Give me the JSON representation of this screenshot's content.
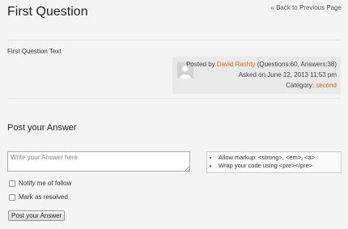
{
  "page": {
    "title": "First Question",
    "back_link": "« Back to Previous Page"
  },
  "question": {
    "text": "First Question Text",
    "author": {
      "posted_by_label": "Posted by",
      "name": "David Rashty",
      "stats": "(Questions:60, Answers:38)",
      "asked_on": "Asked on June 12, 2013 11:53 pm",
      "category_label": "Category:",
      "category": "second"
    }
  },
  "answer_form": {
    "heading": "Post your Answer",
    "placeholder": "Write your Answer here",
    "markup_help": [
      "Allow markup: <strong>, <em>, <a>",
      "Wrap your code using <pre></pre>"
    ],
    "notify_label": "Notify me of follow",
    "resolved_label": "Mark as resolved",
    "submit_label": "Post your Answer"
  },
  "colors": {
    "link": "#d96a17",
    "background": "#f4f4f4"
  }
}
